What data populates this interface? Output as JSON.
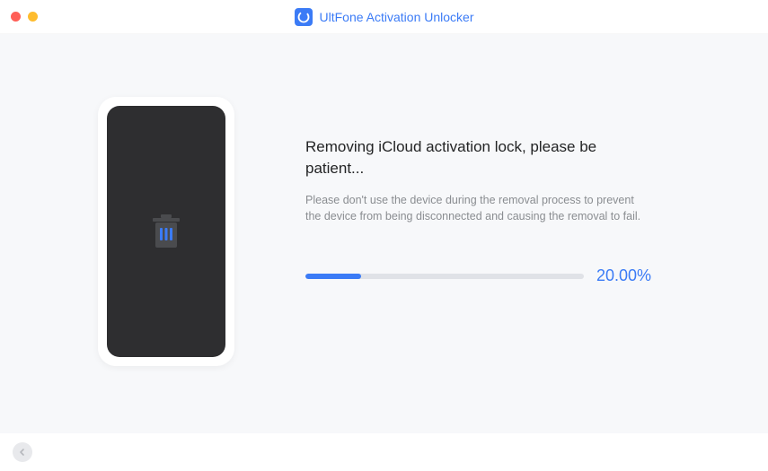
{
  "app": {
    "title": "UltFone Activation Unlocker"
  },
  "main": {
    "heading": "Removing iCloud activation lock, please be patient...",
    "subtext": "Please don't use the device during the removal process to prevent the device from being disconnected and causing the removal to fail.",
    "progress_percent": "20.00%",
    "progress_value": 20
  },
  "colors": {
    "accent": "#3b7bf6"
  }
}
